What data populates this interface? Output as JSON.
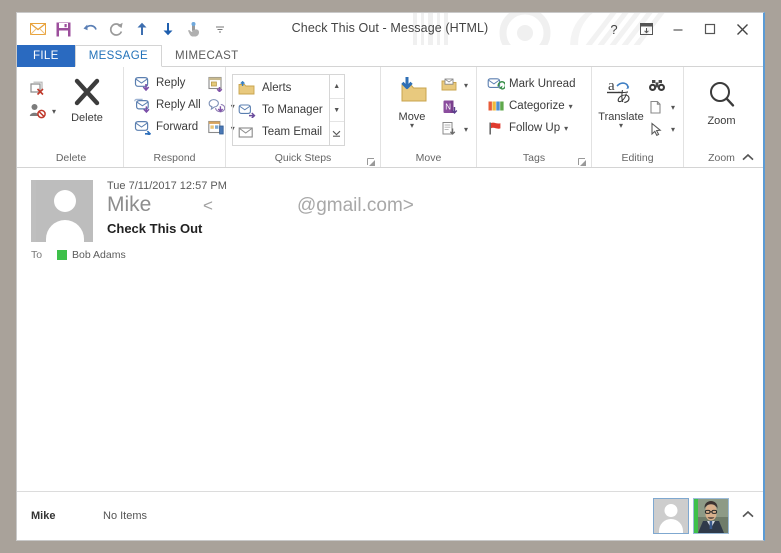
{
  "window": {
    "title": "Check This Out - Message (HTML)",
    "accent_color": "#5b9bd5"
  },
  "quick_access_toolbar": {
    "items": [
      {
        "name": "mail-icon",
        "label": "Mail"
      },
      {
        "name": "save-icon",
        "label": "Save"
      },
      {
        "name": "undo-icon",
        "label": "Undo"
      },
      {
        "name": "redo-icon",
        "label": "Redo"
      },
      {
        "name": "previous-item-icon",
        "label": "Previous Item"
      },
      {
        "name": "next-item-icon",
        "label": "Next Item"
      },
      {
        "name": "touch-mode-icon",
        "label": "Touch/Mouse Mode"
      },
      {
        "name": "customize-qat-icon",
        "label": "Customize Quick Access Toolbar"
      }
    ]
  },
  "titlebar_buttons": {
    "help": "?",
    "ribbon_display": "⊡",
    "minimize": "–",
    "maximize": "☐",
    "close": "✕"
  },
  "tabs": [
    {
      "label": "FILE",
      "active": false,
      "style": "file"
    },
    {
      "label": "MESSAGE",
      "active": true,
      "style": "normal"
    },
    {
      "label": "MIMECAST",
      "active": false,
      "style": "normal"
    }
  ],
  "ribbon": {
    "collapse_label": "˄",
    "groups": [
      {
        "name": "delete",
        "label": "Delete",
        "has_launcher": false,
        "small_buttons": [
          {
            "label": "",
            "icon": "ignore-icon",
            "caret": false
          },
          {
            "label": "",
            "icon": "junk-icon",
            "caret": true
          }
        ],
        "big_buttons": [
          {
            "label": "Delete",
            "icon": "delete-x-icon",
            "caret": false
          }
        ]
      },
      {
        "name": "respond",
        "label": "Respond",
        "has_launcher": false,
        "small_buttons": [
          {
            "label": "Reply",
            "icon": "reply-icon",
            "caret": false
          },
          {
            "label": "Reply All",
            "icon": "reply-all-icon",
            "caret": false
          },
          {
            "label": "Forward",
            "icon": "forward-icon",
            "caret": false
          }
        ],
        "icon_buttons": [
          {
            "icon": "meeting-icon",
            "caret": false
          },
          {
            "icon": "im-icon",
            "caret": true
          },
          {
            "icon": "more-respond-icon",
            "caret": true
          }
        ]
      },
      {
        "name": "quick-steps",
        "label": "Quick Steps",
        "has_launcher": true,
        "gallery": [
          {
            "label": "Alerts",
            "icon": "alerts-folder-icon"
          },
          {
            "label": "To Manager",
            "icon": "to-manager-icon"
          },
          {
            "label": "Team Email",
            "icon": "team-email-icon"
          }
        ],
        "scroll": [
          "▲",
          "▼",
          "▼̲"
        ]
      },
      {
        "name": "move",
        "label": "Move",
        "has_launcher": false,
        "big_buttons": [
          {
            "label": "Move",
            "icon": "move-folder-icon",
            "caret": true
          }
        ],
        "icon_buttons": [
          {
            "icon": "rules-icon",
            "caret": true
          },
          {
            "icon": "onenote-icon",
            "caret": false
          },
          {
            "icon": "actions-icon",
            "caret": true
          }
        ]
      },
      {
        "name": "tags",
        "label": "Tags",
        "has_launcher": true,
        "small_buttons": [
          {
            "label": "Mark Unread",
            "icon": "mark-unread-icon",
            "caret": false
          },
          {
            "label": "Categorize",
            "icon": "categorize-icon",
            "caret": true
          },
          {
            "label": "Follow Up",
            "icon": "follow-up-flag-icon",
            "caret": true
          }
        ]
      },
      {
        "name": "editing",
        "label": "Editing",
        "has_launcher": false,
        "big_buttons": [
          {
            "label": "Translate",
            "icon": "translate-icon",
            "caret": true
          }
        ],
        "icon_buttons": [
          {
            "icon": "find-binoculars-icon",
            "caret": false
          },
          {
            "icon": "related-icon",
            "caret": true
          },
          {
            "icon": "select-cursor-icon",
            "caret": true
          }
        ]
      },
      {
        "name": "zoom",
        "label": "Zoom",
        "has_launcher": false,
        "big_buttons": [
          {
            "label": "Zoom",
            "icon": "zoom-magnifier-icon",
            "caret": false
          }
        ]
      }
    ]
  },
  "message": {
    "date": "Tue 7/11/2017 12:57 PM",
    "sender_name": "Mike",
    "email_open_bracket": "<",
    "sender_email": "@gmail.com>",
    "subject": "Check This Out",
    "to_label": "To",
    "to_recipient": "Bob Adams",
    "to_presence_color": "#3ec04a",
    "body": ""
  },
  "status_bar": {
    "account_name": "Mike",
    "item_count": "No Items",
    "expand_caret": "˄",
    "people_cards": [
      {
        "name": "person-card-generic",
        "type": "placeholder"
      },
      {
        "name": "person-card-photo",
        "type": "photo",
        "presence_color": "#3ec04a"
      }
    ]
  }
}
